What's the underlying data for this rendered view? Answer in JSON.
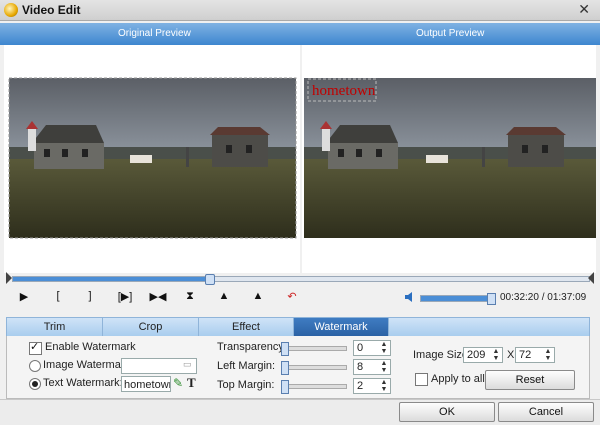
{
  "window": {
    "title": "Video Edit",
    "close_glyph": "✕"
  },
  "preview": {
    "original_label": "Original Preview",
    "output_label": "Output Preview",
    "watermark_text": "hometown"
  },
  "playback": {
    "progress": 0.34,
    "controls": [
      "▶",
      "[",
      "]",
      "[▶]",
      "▶◀",
      "⧗",
      "▲",
      "▲",
      "↶"
    ],
    "volume": 0.95,
    "time": "00:32:20 / 01:37:09"
  },
  "tabs": [
    {
      "label": "Trim",
      "active": false
    },
    {
      "label": "Crop",
      "active": false
    },
    {
      "label": "Effect",
      "active": false
    },
    {
      "label": "Watermark",
      "active": true
    }
  ],
  "watermark": {
    "enable_label": "Enable Watermark",
    "image_label": "Image Watermark:",
    "text_label": "Text Watermark:",
    "text_value": "hometown",
    "transparency_label": "Transparency:",
    "transparency_value": "0",
    "left_margin_label": "Left Margin:",
    "left_margin_value": "8",
    "top_margin_label": "Top  Margin:",
    "top_margin_value": "2",
    "image_size_label": "Image Size:",
    "width_value": "209",
    "x_label": "X",
    "height_value": "72",
    "apply_all_label": "Apply to all",
    "reset_label": "Reset"
  },
  "buttons": {
    "ok": "OK",
    "cancel": "Cancel"
  },
  "colors": {
    "accent": "#2b62a5",
    "header": "#4c8fd3",
    "watermark": "#c10000"
  }
}
